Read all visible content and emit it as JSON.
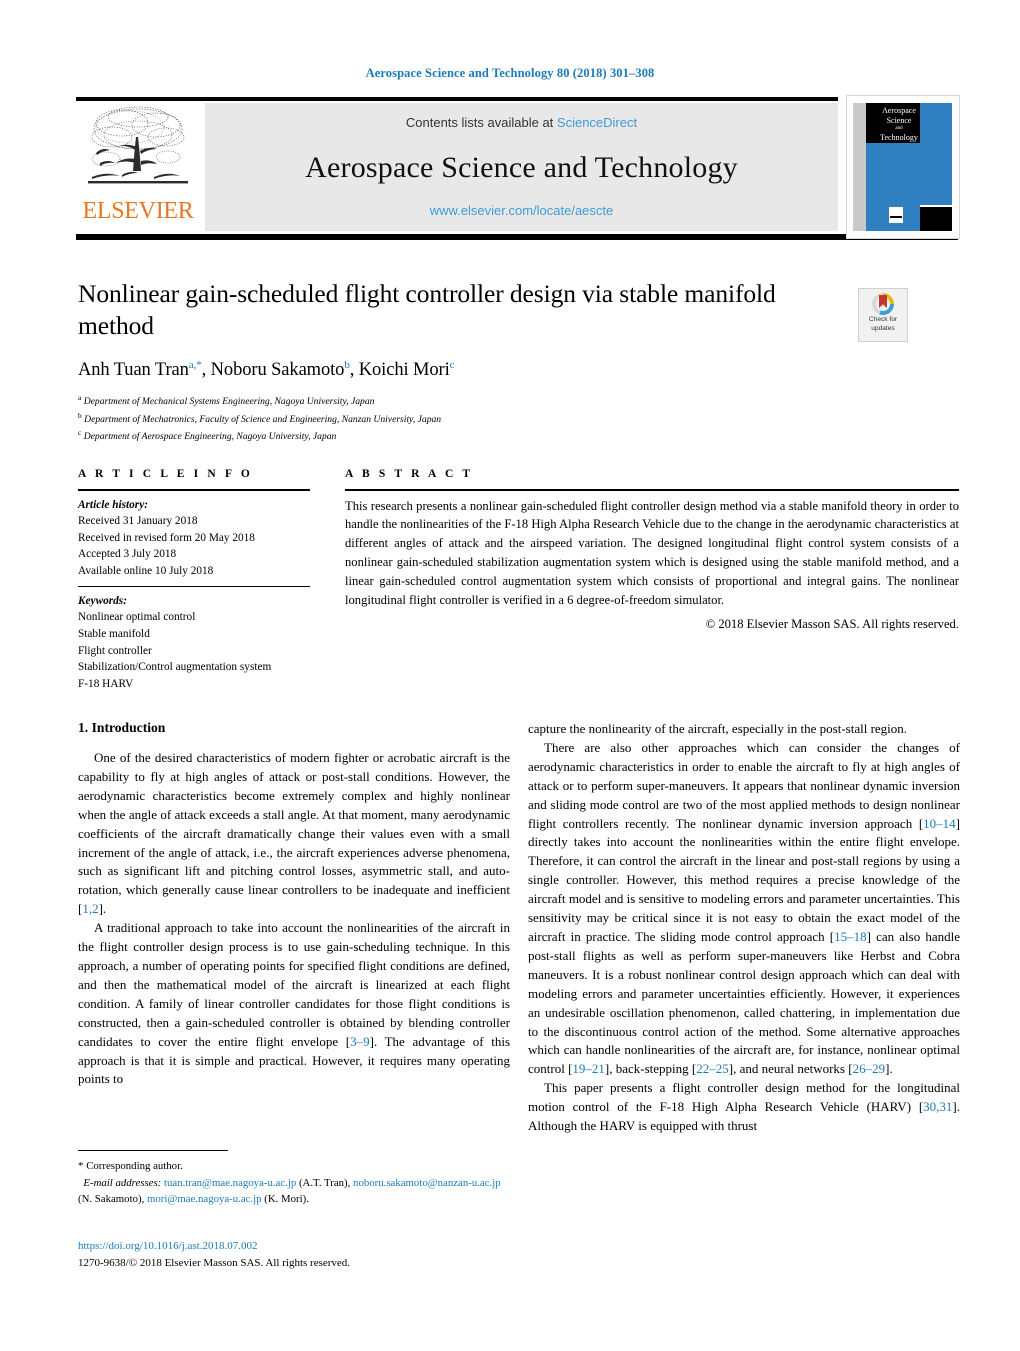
{
  "running_head": "Aerospace Science and Technology 80 (2018) 301–308",
  "masthead": {
    "contents_prefix": "Contents lists available at ",
    "sciencedirect": "ScienceDirect",
    "journal_title": "Aerospace Science and Technology",
    "journal_url": "www.elsevier.com/locate/aescte",
    "publisher": "ELSEVIER",
    "cover_title_line1": "Aerospace",
    "cover_title_line2": "Science",
    "cover_title_and": "and",
    "cover_title_line3": "Technology"
  },
  "crossmark": {
    "line1": "Check for",
    "line2": "updates"
  },
  "article": {
    "title": "Nonlinear gain-scheduled flight controller design via stable manifold method",
    "authors_html": "Anh Tuan Tran<sup>a,*</sup>, Noboru Sakamoto<sup>b</sup>, Koichi Mori<sup>c</sup>",
    "affiliations": [
      {
        "marker": "a",
        "text": "Department of Mechanical Systems Engineering, Nagoya University, Japan"
      },
      {
        "marker": "b",
        "text": "Department of Mechatronics, Faculty of Science and Engineering, Nanzan University, Japan"
      },
      {
        "marker": "c",
        "text": "Department of Aerospace Engineering, Nagoya University, Japan"
      }
    ]
  },
  "info": {
    "heading": "A R T I C L E   I N F O",
    "history_label": "Article history:",
    "history": [
      "Received 31 January 2018",
      "Received in revised form 20 May 2018",
      "Accepted 3 July 2018",
      "Available online 10 July 2018"
    ],
    "keywords_label": "Keywords:",
    "keywords": [
      "Nonlinear optimal control",
      "Stable manifold",
      "Flight controller",
      "Stabilization/Control augmentation system",
      "F-18 HARV"
    ]
  },
  "abstract": {
    "heading": "A B S T R A C T",
    "body": "This research presents a nonlinear gain-scheduled flight controller design method via a stable manifold theory in order to handle the nonlinearities of the F-18 High Alpha Research Vehicle due to the change in the aerodynamic characteristics at different angles of attack and the airspeed variation. The designed longitudinal flight control system consists of a nonlinear gain-scheduled stabilization augmentation system which is designed using the stable manifold method, and a linear gain-scheduled control augmentation system which consists of proportional and integral gains. The nonlinear longitudinal flight controller is verified in a 6 degree-of-freedom simulator.",
    "copyright": "© 2018 Elsevier Masson SAS. All rights reserved."
  },
  "sections": {
    "introduction_heading": "1. Introduction"
  },
  "body_left": {
    "p1": "One of the desired characteristics of modern fighter or acrobatic aircraft is the capability to fly at high angles of attack or post-stall conditions. However, the aerodynamic characteristics become extremely complex and highly nonlinear when the angle of attack exceeds a stall angle. At that moment, many aerodynamic coefficients of the aircraft dramatically change their values even with a small increment of the angle of attack, i.e., the aircraft experiences adverse phenomena, such as significant lift and pitching control losses, asymmetric stall, and auto-rotation, which generally cause linear controllers to be inadequate and inefficient [",
    "p1_ref": "1,2",
    "p1_end": "].",
    "p2_a": "A traditional approach to take into account the nonlinearities of the aircraft in the flight controller design process is to use gain-scheduling technique. In this approach, a number of operating points for specified flight conditions are defined, and then the mathematical model of the aircraft is linearized at each flight condition. A family of linear controller candidates for those flight conditions is constructed, then a gain-scheduled controller is obtained by blending controller candidates to cover the entire flight envelope [",
    "p2_ref": "3–9",
    "p2_b": "]. The advantage of this approach is that it is simple and practical. However, it requires many operating points to"
  },
  "body_right": {
    "p1": "capture the nonlinearity of the aircraft, especially in the post-stall region.",
    "p2_a": "There are also other approaches which can consider the changes of aerodynamic characteristics in order to enable the aircraft to fly at high angles of attack or to perform super-maneuvers. It appears that nonlinear dynamic inversion and sliding mode control are two of the most applied methods to design nonlinear flight controllers recently. The nonlinear dynamic inversion approach [",
    "p2_ref1": "10–14",
    "p2_b": "] directly takes into account the nonlinearities within the entire flight envelope. Therefore, it can control the aircraft in the linear and post-stall regions by using a single controller. However, this method requires a precise knowledge of the aircraft model and is sensitive to modeling errors and parameter uncertainties. This sensitivity may be critical since it is not easy to obtain the exact model of the aircraft in practice. The sliding mode control approach [",
    "p2_ref2": "15–18",
    "p2_c": "] can also handle post-stall flights as well as perform super-maneuvers like Herbst and Cobra maneuvers. It is a robust nonlinear control design approach which can deal with modeling errors and parameter uncertainties efficiently. However, it experiences an undesirable oscillation phenomenon, called chattering, in implementation due to the discontinuous control action of the method. Some alternative approaches which can handle nonlinearities of the aircraft are, for instance, nonlinear optimal control [",
    "p2_ref3": "19–21",
    "p2_d": "], back-stepping [",
    "p2_ref4": "22–25",
    "p2_e": "], and neural networks [",
    "p2_ref5": "26–29",
    "p2_f": "].",
    "p3_a": "This paper presents a flight controller design method for the longitudinal motion control of the F-18 High Alpha Research Vehicle (HARV) [",
    "p3_ref": "30,31",
    "p3_b": "]. Although the HARV is equipped with thrust"
  },
  "footnote": {
    "star": "*",
    "corresponding": "Corresponding author.",
    "email_label": "E-mail addresses:",
    "email1": "tuan.tran@mae.nagoya-u.ac.jp",
    "email1_owner": "(A.T. Tran),",
    "email2": "noboru.sakamoto@nanzan-u.ac.jp",
    "email2_owner": "(N. Sakamoto),",
    "email3": "mori@mae.nagoya-u.ac.jp",
    "email3_owner": "(K. Mori)."
  },
  "doi_block": {
    "doi": "https://doi.org/10.1016/j.ast.2018.07.002",
    "issn_line": "1270-9638/© 2018 Elsevier Masson SAS. All rights reserved."
  },
  "colors": {
    "link_blue": "#1a7bb9",
    "sciencedirect_blue": "#3d9bd4",
    "elsevier_orange": "#e87722",
    "cover_blue": "#2f7fc1"
  }
}
